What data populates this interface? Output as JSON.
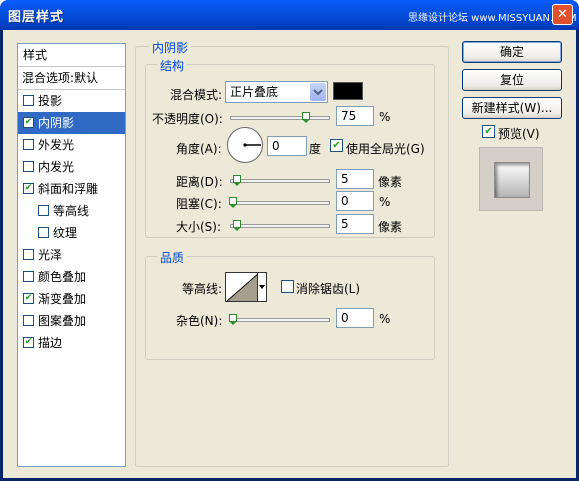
{
  "window": {
    "title": "图层样式",
    "watermark": "思缘设计论坛 www.MISSYUAN.COM",
    "close_glyph": "✕"
  },
  "styles_list": {
    "header": "样式",
    "blend_options": "混合选项:默认",
    "items": [
      {
        "label": "投影",
        "checked": false,
        "selected": false,
        "indent": 0
      },
      {
        "label": "内阴影",
        "checked": true,
        "selected": true,
        "indent": 0
      },
      {
        "label": "外发光",
        "checked": false,
        "selected": false,
        "indent": 0
      },
      {
        "label": "内发光",
        "checked": false,
        "selected": false,
        "indent": 0
      },
      {
        "label": "斜面和浮雕",
        "checked": true,
        "selected": false,
        "indent": 0
      },
      {
        "label": "等高线",
        "checked": false,
        "selected": false,
        "indent": 1
      },
      {
        "label": "纹理",
        "checked": false,
        "selected": false,
        "indent": 1
      },
      {
        "label": "光泽",
        "checked": false,
        "selected": false,
        "indent": 0
      },
      {
        "label": "颜色叠加",
        "checked": false,
        "selected": false,
        "indent": 0
      },
      {
        "label": "渐变叠加",
        "checked": true,
        "selected": false,
        "indent": 0
      },
      {
        "label": "图案叠加",
        "checked": false,
        "selected": false,
        "indent": 0
      },
      {
        "label": "描边",
        "checked": true,
        "selected": false,
        "indent": 0
      }
    ]
  },
  "inner_shadow": {
    "section_title": "内阴影",
    "structure": {
      "title": "结构",
      "blend_mode_label": "混合模式:",
      "blend_mode_value": "正片叠底",
      "shadow_color": "#000000",
      "opacity_label": "不透明度(O):",
      "opacity_value": "75",
      "opacity_unit": "%",
      "opacity_level": 0.75,
      "angle_label": "角度(A):",
      "angle_value": "0",
      "angle_unit": "度",
      "global_light_label": "使用全局光(G)",
      "global_light_checked": true,
      "distance_label": "距离(D):",
      "distance_value": "5",
      "distance_unit": "像素",
      "choke_label": "阻塞(C):",
      "choke_value": "0",
      "choke_unit": "%",
      "size_label": "大小(S):",
      "size_value": "5",
      "size_unit": "像素"
    },
    "quality": {
      "title": "品质",
      "contour_label": "等高线:",
      "antialias_label": "消除锯齿(L)",
      "antialias_checked": false,
      "noise_label": "杂色(N):",
      "noise_value": "0",
      "noise_unit": "%"
    }
  },
  "buttons": {
    "ok": "确定",
    "reset": "复位",
    "new_style": "新建样式(W)...",
    "preview_label": "预览(V)",
    "preview_checked": true
  }
}
